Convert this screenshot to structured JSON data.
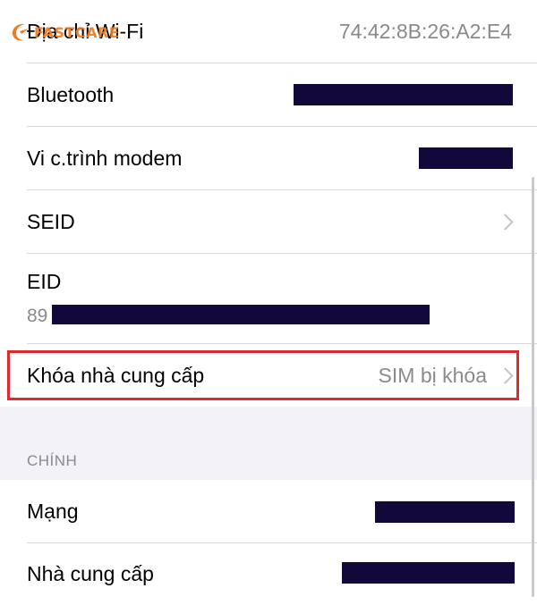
{
  "rows": {
    "wifi": {
      "label": "Địa chỉ Wi-Fi",
      "value": "74:42:8B:26:A2:E4"
    },
    "bluetooth": {
      "label": "Bluetooth"
    },
    "modem": {
      "label": "Vi c.trình modem"
    },
    "seid": {
      "label": "SEID"
    },
    "eid": {
      "label": "EID",
      "value_prefix": "89"
    },
    "carrier_lock": {
      "label": "Khóa nhà cung cấp",
      "value": "SIM bị khóa"
    }
  },
  "section": {
    "header": "CHÍNH"
  },
  "rows2": {
    "network": {
      "label": "Mạng"
    },
    "carrier": {
      "label": "Nhà cung cấp"
    }
  },
  "watermark": {
    "text": "FASTCARE"
  },
  "colors": {
    "redaction": "#12093a",
    "highlight": "#e0282e",
    "secondary_text": "#8a8a8e",
    "group_background": "#f2f2f7"
  }
}
